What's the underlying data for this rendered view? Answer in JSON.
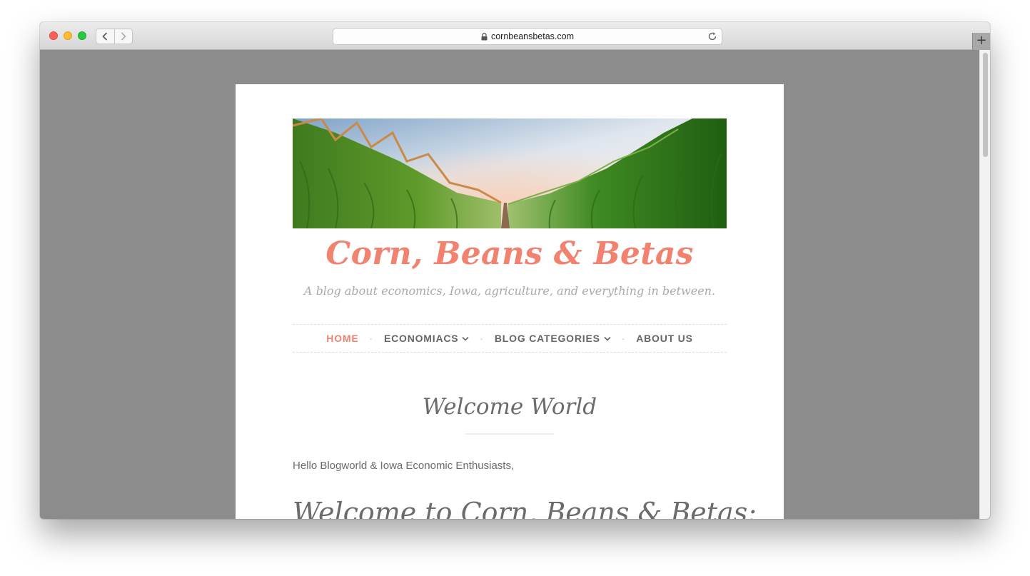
{
  "browser": {
    "url": "cornbeansbetas.com",
    "new_tab_symbol": "+"
  },
  "site": {
    "title": "Corn, Beans & Betas",
    "tagline": "A blog about economics, Iowa, agriculture, and everything in between.",
    "nav": [
      {
        "label": "HOME",
        "active": true,
        "dropdown": false
      },
      {
        "label": "ECONOMIACS",
        "active": false,
        "dropdown": true
      },
      {
        "label": "BLOG CATEGORIES",
        "active": false,
        "dropdown": true
      },
      {
        "label": "ABOUT US",
        "active": false,
        "dropdown": false
      }
    ],
    "nav_separator": "·"
  },
  "post": {
    "title": "Welcome World",
    "greeting": "Hello Blogworld & Iowa Economic Enthusiasts,",
    "heading": "Welcome to Corn, Beans & Betas:"
  },
  "colors": {
    "accent": "#f0826f",
    "text": "#6b6b6b",
    "muted": "#a9a9a9",
    "page_bg": "#8c8c8c"
  },
  "icons": {
    "back": "chevron-left-icon",
    "forward": "chevron-right-icon",
    "lock": "lock-icon",
    "reload": "reload-icon",
    "dropdown": "chevron-down-icon"
  }
}
